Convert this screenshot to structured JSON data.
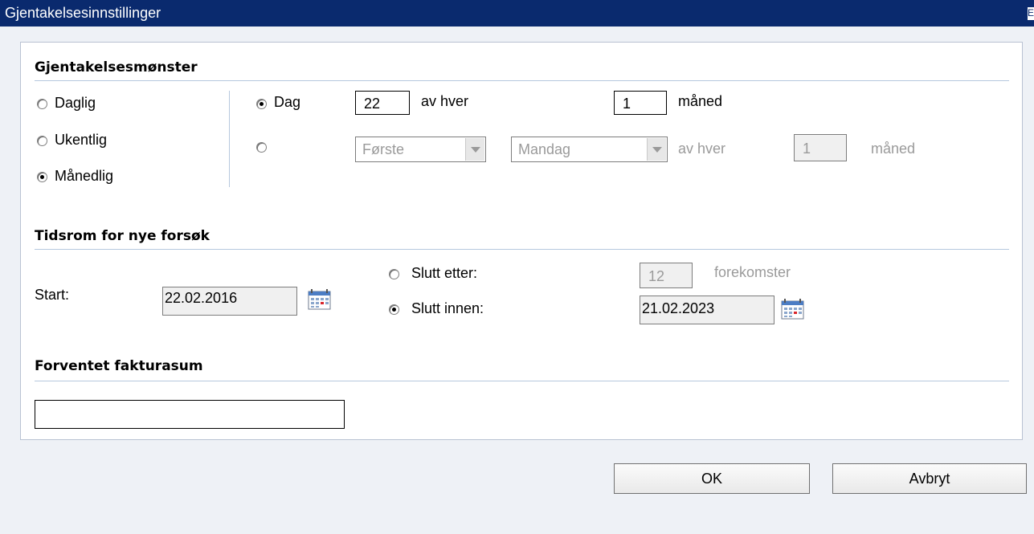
{
  "window": {
    "title": "Gjentakelsesinnstillinger",
    "close": "E"
  },
  "pattern": {
    "heading": "Gjentakelsesmønster",
    "types": {
      "daily": "Daglig",
      "weekly": "Ukentlig",
      "monthly": "Månedlig",
      "selected": "Månedlig"
    },
    "option1": {
      "label": "Dag",
      "day_value": "22",
      "of_every": "av hver",
      "month_value": "1",
      "month_unit": "måned"
    },
    "option2": {
      "ordinal": "Første",
      "weekday": "Mandag",
      "of_every": "av hver",
      "month_value": "1",
      "month_unit": "måned"
    }
  },
  "range": {
    "heading": "Tidsrom for nye forsøk",
    "start_label": "Start:",
    "start_value": "22.02.2016",
    "end_after_label": "Slutt etter:",
    "end_after_value": "12",
    "occurrences_label": "forekomster",
    "end_by_label": "Slutt innen:",
    "end_by_value": "21.02.2023",
    "selected": "Slutt innen:"
  },
  "invoice": {
    "heading": "Forventet fakturasum",
    "value": ""
  },
  "buttons": {
    "ok": "OK",
    "cancel": "Avbryt"
  },
  "colors": {
    "titlebar": "#0a2a6e",
    "background": "#eef1f6",
    "section_line": "#b6c8de"
  },
  "icons": {
    "calendar": "calendar-icon",
    "dropdown": "chevron-down-icon"
  }
}
